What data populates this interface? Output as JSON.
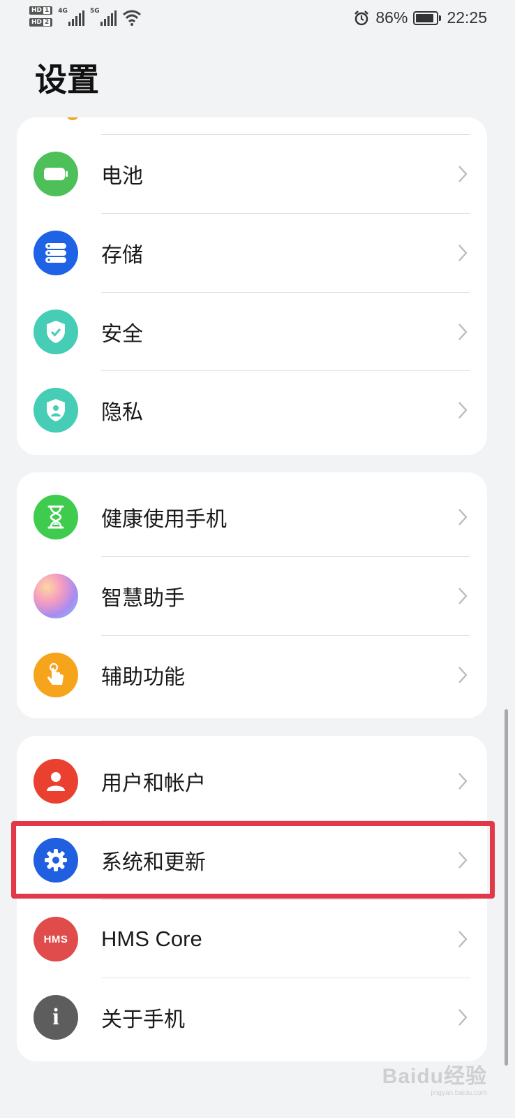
{
  "status_bar": {
    "hd1": "HD",
    "hd1_n": "1",
    "hd2": "HD",
    "hd2_n": "2",
    "sim1_net": "4G",
    "sim2_net": "5G",
    "battery_percent": "86%",
    "time": "22:25",
    "battery_level": 0.86
  },
  "page": {
    "title": "设置"
  },
  "groups": [
    {
      "items": [
        {
          "label": "电池",
          "icon": "battery-icon",
          "color": "#4dc05a"
        },
        {
          "label": "存储",
          "icon": "storage-icon",
          "color": "#1e62e6"
        },
        {
          "label": "安全",
          "icon": "shield-check-icon",
          "color": "#46cdb5"
        },
        {
          "label": "隐私",
          "icon": "privacy-shield-icon",
          "color": "#46cdb5"
        }
      ]
    },
    {
      "items": [
        {
          "label": "健康使用手机",
          "icon": "hourglass-icon",
          "color": "#3fcb4e"
        },
        {
          "label": "智慧助手",
          "icon": "assistant-orb-icon",
          "color": "#c9a0e8"
        },
        {
          "label": "辅助功能",
          "icon": "hand-tap-icon",
          "color": "#f7a41d"
        }
      ]
    },
    {
      "items": [
        {
          "label": "用户和帐户",
          "icon": "user-icon",
          "color": "#ea4030"
        },
        {
          "label": "系统和更新",
          "icon": "gear-icon",
          "color": "#1f5fe0"
        },
        {
          "label": "HMS Core",
          "icon": "hms-icon",
          "icon_text": "HMS",
          "color": "#e04b4b"
        },
        {
          "label": "关于手机",
          "icon": "info-icon",
          "icon_text": "i",
          "color": "#5d5d5d"
        }
      ]
    }
  ],
  "highlight_target": "系统和更新",
  "watermark": {
    "text": "Baidu经验",
    "sub": "jingyan.baidu.com"
  }
}
